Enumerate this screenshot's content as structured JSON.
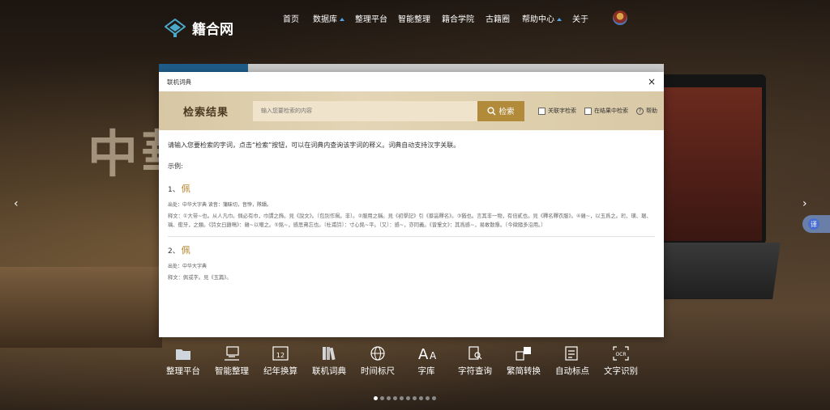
{
  "site": {
    "logo_text": "籍合网"
  },
  "nav": {
    "items": [
      {
        "label": "首页",
        "caret": false
      },
      {
        "label": "数据库",
        "caret": true
      },
      {
        "label": "整理平台",
        "caret": false
      },
      {
        "label": "智能整理",
        "caret": false
      },
      {
        "label": "籍合学院",
        "caret": false
      },
      {
        "label": "古籍圈",
        "caret": false
      },
      {
        "label": "帮助中心",
        "caret": true
      },
      {
        "label": "关于",
        "caret": false
      }
    ]
  },
  "hero": {
    "deco_text": "中華"
  },
  "float_button": {
    "label": "译"
  },
  "modal": {
    "title": "联机词典",
    "close_label": "×",
    "band_title": "检索结果",
    "search_placeholder": "输入您要检索的内容",
    "search_button": "检索",
    "options": {
      "related": "关联字检索",
      "in_results": "在结果中检索",
      "help": "帮助"
    },
    "intro": "请输入您要检索的字词，点击“检索”按钮，可以在词典内查询该字词的释义。词典自动支持汉字关联。",
    "example_label": "示例:",
    "entries": [
      {
        "num": "1、",
        "char": "佩",
        "source": "出处：中华大字典   读音：蒲昧切，音悖，隊韻。",
        "definition": "释文：①大带~也。从人凡巾。佩必有巾，巾謂之飾。見《說文》。〔包別作珮。非〕。②服用之稱。見《初學記》引《蔡邕釋名》。③猶也。言其非一物，有倍貳也。見《釋名釋衣服》。④雜~，以玉爲之。珩、璜、琚、瑀、衝牙，之類。《詩女曰雞鳴》：雜~以贈之。⑤銘~，感思弗忘也。〔杜甫詩〕：寸心銘~平。〔又〕：感~，亦同義。《曾鞏文》：其爲感~，易敢散隳。〔今徵隨多沿用。〕"
      },
      {
        "num": "2、",
        "char": "佩",
        "source": "出处：中华大字典",
        "definition": "释文：佩或字。見《玉篇》。"
      }
    ]
  },
  "toolbar": {
    "items": [
      {
        "label": "整理平台",
        "icon": "folder-icon"
      },
      {
        "label": "智能整理",
        "icon": "smart-arrange-icon"
      },
      {
        "label": "纪年换算",
        "icon": "calendar-icon"
      },
      {
        "label": "联机词典",
        "icon": "books-icon"
      },
      {
        "label": "时间标尺",
        "icon": "globe-icon"
      },
      {
        "label": "字库",
        "icon": "font-icon"
      },
      {
        "label": "字符查询",
        "icon": "character-search-icon"
      },
      {
        "label": "繁简转换",
        "icon": "convert-icon"
      },
      {
        "label": "自动标点",
        "icon": "punctuation-icon"
      },
      {
        "label": "文字识别",
        "icon": "ocr-icon"
      }
    ]
  },
  "carousel": {
    "dot_count": 10,
    "active_index": 0
  }
}
